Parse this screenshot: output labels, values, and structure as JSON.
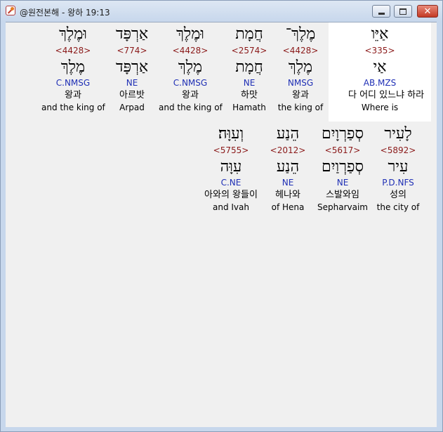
{
  "window": {
    "title": "@원전본해 - 왕하 19:13",
    "buttons": {
      "minimize": "minimize",
      "maximize": "maximize",
      "close": "✕"
    }
  },
  "rows": [
    [
      {
        "hebrew": "אַיֵּו",
        "strong": "<335>",
        "lemma": "אַי",
        "morph": "AB.MZS",
        "korean": "다 어디 있느냐 하라",
        "english": "Where is",
        "highlight": true
      },
      {
        "hebrew": "מֶלֶךְ־",
        "strong": "<4428>",
        "lemma": "מֶלֶךְ",
        "morph": "NMSG",
        "korean": "왕과",
        "english": "the king of"
      },
      {
        "hebrew": "חֲמָת",
        "strong": "<2574>",
        "lemma": "חֲמָת",
        "morph": "NE",
        "korean": "하맛",
        "english": "Hamath"
      },
      {
        "hebrew": "וּמֶלֶךְ",
        "strong": "<4428>",
        "lemma": "מֶלֶךְ",
        "morph": "C.NMSG",
        "korean": "왕과",
        "english": "and the king of"
      },
      {
        "hebrew": "אַרְפָּד",
        "strong": "<774>",
        "lemma": "אַרְפָּד",
        "morph": "NE",
        "korean": "아르밧",
        "english": "Arpad"
      },
      {
        "hebrew": "וּמֶלֶךְ",
        "strong": "<4428>",
        "lemma": "מֶלֶךְ",
        "morph": "C.NMSG",
        "korean": "왕과",
        "english": "and the king of"
      }
    ],
    [
      {
        "hebrew": "לָעִיר",
        "strong": "<5892>",
        "lemma": "עִיר",
        "morph": "P.D.NFS",
        "korean": "성의",
        "english": "the city of"
      },
      {
        "hebrew": "סְפַרְוָיִם",
        "strong": "<5617>",
        "lemma": "סְפַרְוַיִם",
        "morph": "NE",
        "korean": "스발와임",
        "english": "Sepharvaim"
      },
      {
        "hebrew": "הֵנַע",
        "strong": "<2012>",
        "lemma": "הֵנַע",
        "morph": "NE",
        "korean": "헤나와",
        "english": "of Hena"
      },
      {
        "hebrew": "וְעִוָּה׃",
        "strong": "<5755>",
        "lemma": "עִוָּה",
        "morph": "C.NE",
        "korean": "아와의 왕들이",
        "english": "and Ivah"
      }
    ]
  ]
}
